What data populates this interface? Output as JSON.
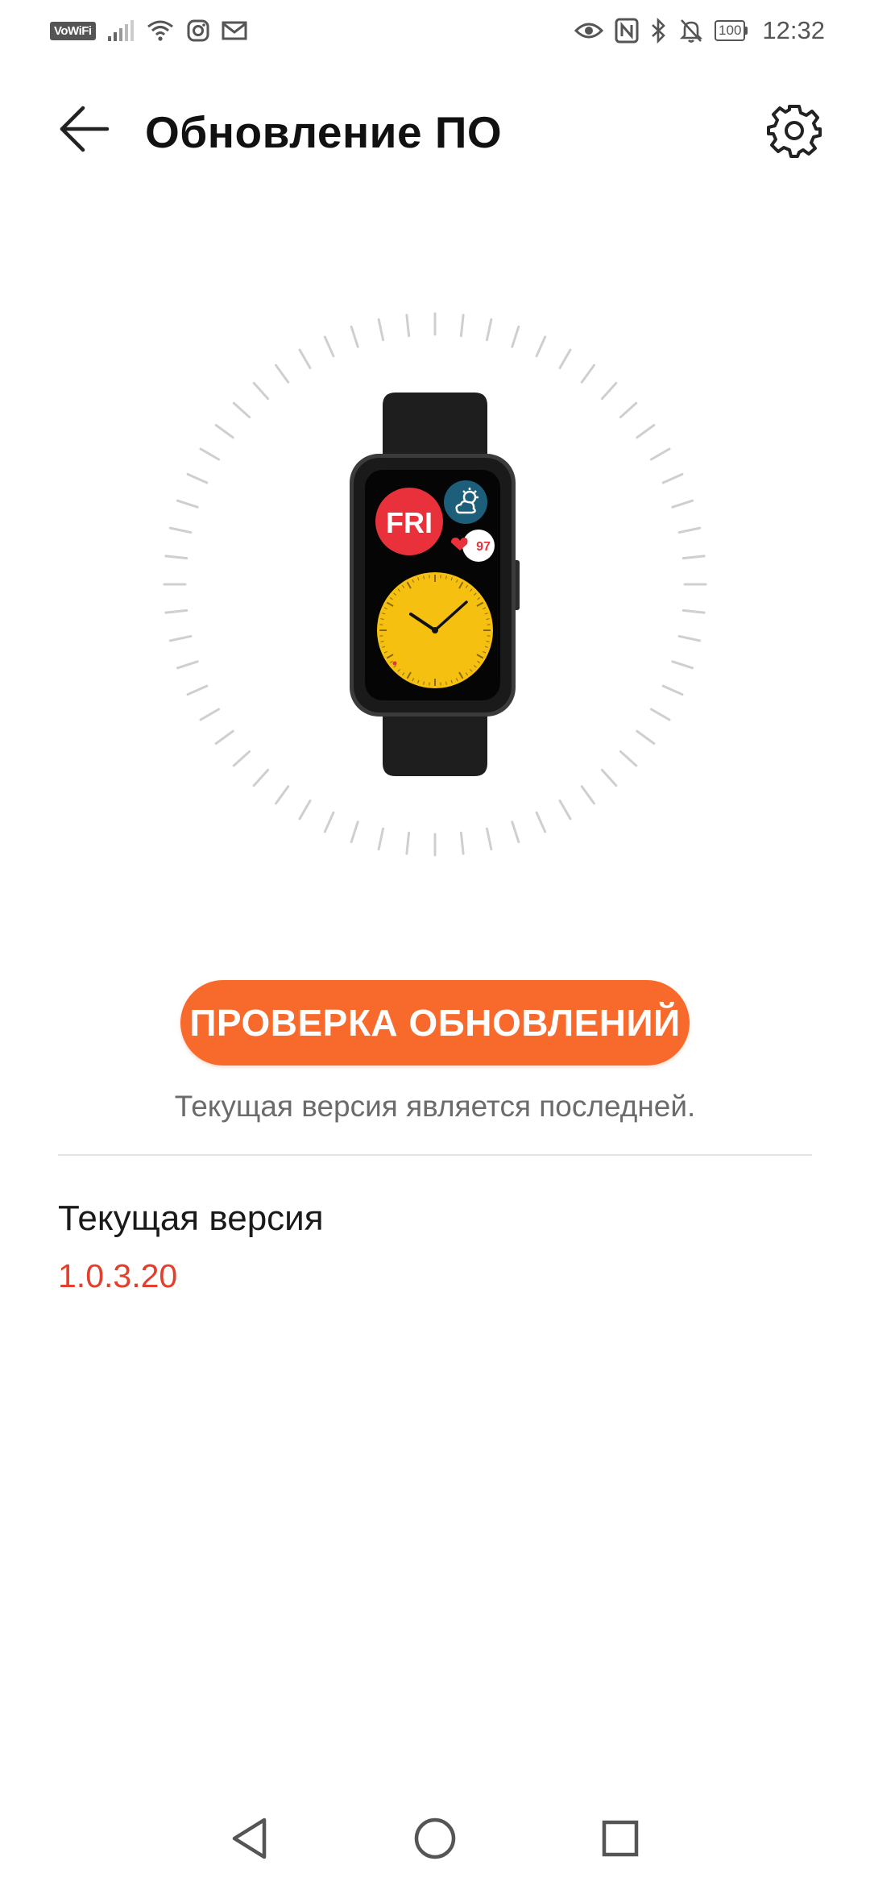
{
  "status_bar": {
    "vowifi_label": "VoWiFi",
    "battery_level": "100",
    "time": "12:32",
    "icons_left": [
      "signal-icon",
      "wifi-icon",
      "instagram-icon",
      "mail-icon"
    ],
    "icons_right": [
      "eye-icon",
      "nfc-icon",
      "bluetooth-icon",
      "bell-off-icon",
      "battery-icon"
    ]
  },
  "header": {
    "title": "Обновление ПО",
    "back_icon": "arrow-left-icon",
    "settings_icon": "gear-icon"
  },
  "watch": {
    "day_label": "FRI",
    "heart_rate": "97",
    "colors": {
      "body": "#2a2a2a",
      "strap": "#1e1e1e",
      "day_bubble": "#e8313b",
      "weather_bubble": "#1d5f7a",
      "dial": "#f6c011"
    }
  },
  "update": {
    "check_button_label": "ПРОВЕРКА ОБНОВЛЕНИЙ",
    "status_message": "Текущая версия является последней.",
    "current_version_label": "Текущая версия",
    "current_version_value": "1.0.3.20"
  },
  "colors": {
    "accent": "#f86a2c",
    "version_text": "#e2402d"
  },
  "nav_bar": {
    "icons": [
      "nav-back-icon",
      "nav-home-icon",
      "nav-recent-icon"
    ]
  }
}
